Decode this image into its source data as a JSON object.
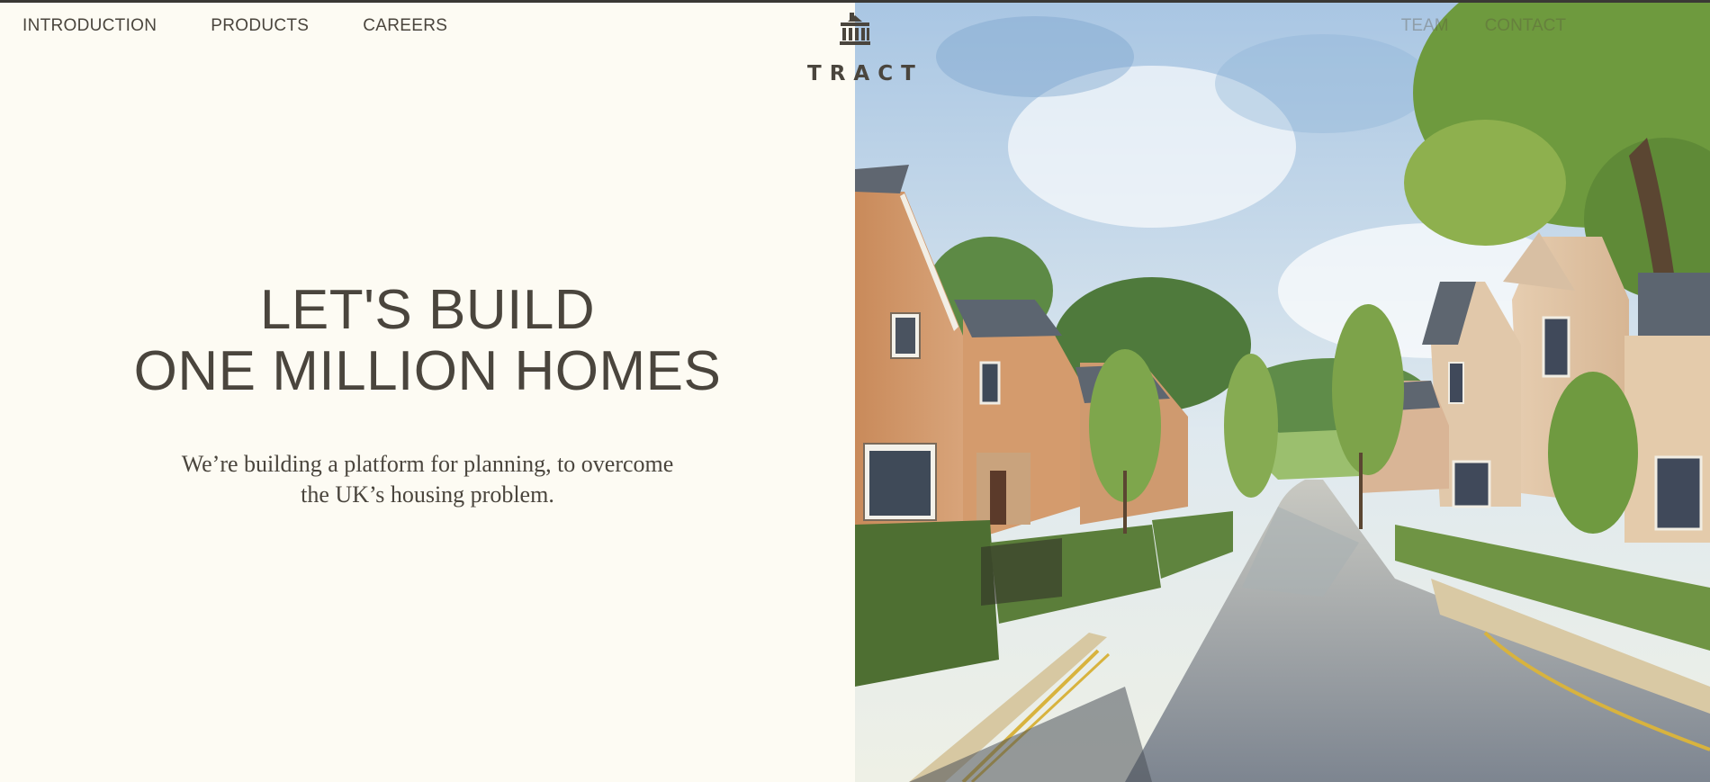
{
  "brand": {
    "name": "TRACT",
    "logo_icon": "building-icon"
  },
  "nav": {
    "left": [
      {
        "label": "INTRODUCTION"
      },
      {
        "label": "PRODUCTS"
      },
      {
        "label": "CAREERS"
      }
    ],
    "right": [
      {
        "label": "TEAM"
      },
      {
        "label": "CONTACT"
      }
    ]
  },
  "hero": {
    "title_line1": "LET'S BUILD",
    "title_line2": "ONE MILLION HOMES",
    "subtitle": "We’re building a platform for planning, to overcome the UK’s housing problem."
  },
  "illustration": {
    "subject": "watercolor street of brick houses"
  },
  "colors": {
    "background": "#fdfbf3",
    "text": "#4a453d",
    "top_bar": "#3a3835"
  }
}
